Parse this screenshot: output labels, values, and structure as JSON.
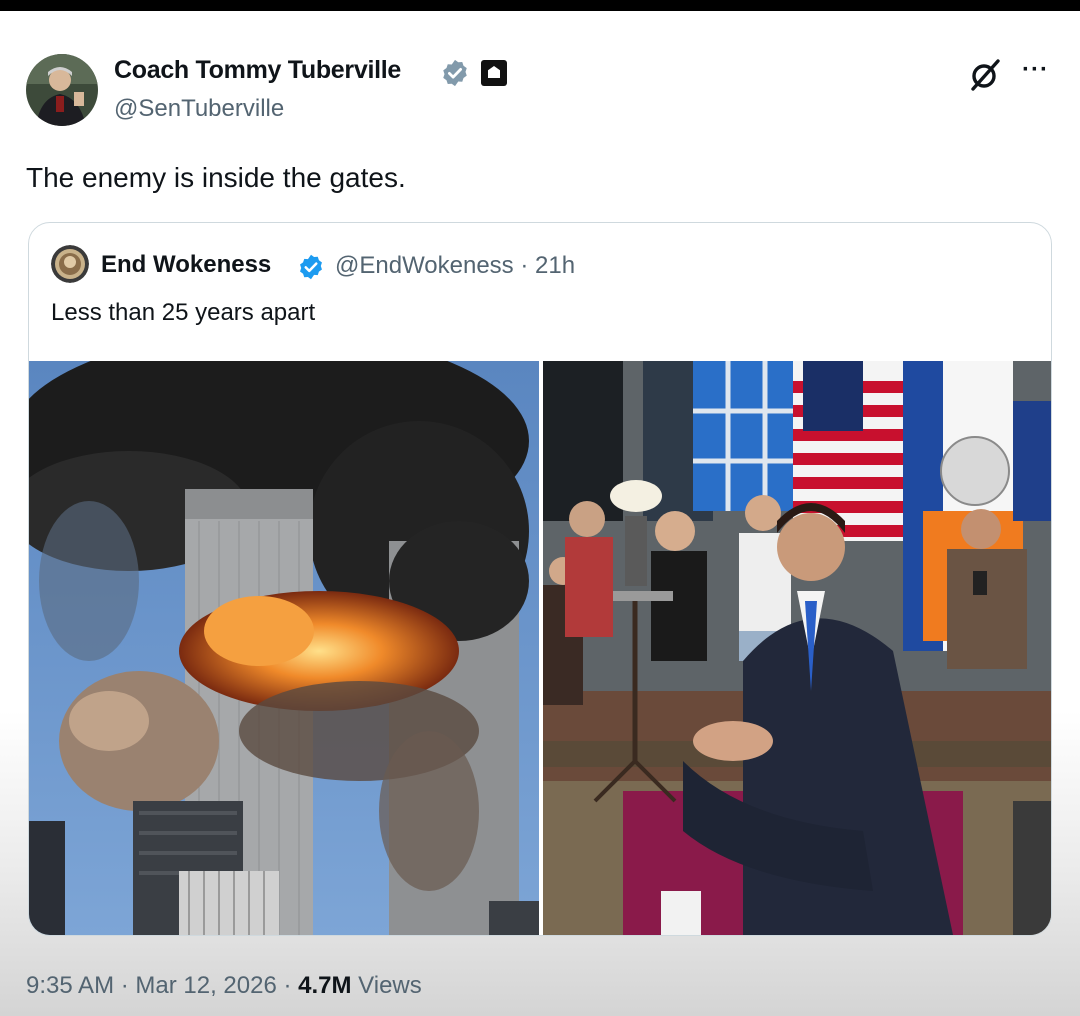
{
  "author": {
    "display_name": "Coach Tommy Tuberville",
    "handle": "@SenTuberville"
  },
  "tweet": {
    "text": "The enemy is inside the gates."
  },
  "quoted_tweet": {
    "display_name": "End Wokeness",
    "handle_time": "@EndWokeness · 21h",
    "text": "Less than 25 years apart"
  },
  "meta": {
    "time_date": "9:35 AM · Mar 12, 2026 · ",
    "views_count": "4.7M",
    "views_label": " Views"
  },
  "icons": {
    "verified": "verified-badge-icon",
    "government": "government-building-icon",
    "grok": "grok-icon",
    "more": "more-options-icon"
  },
  "colors": {
    "verified_blue": "#1d9bf0",
    "verified_gray": "#829aab",
    "secondary_text": "#536471",
    "primary_text": "#0f1419"
  }
}
